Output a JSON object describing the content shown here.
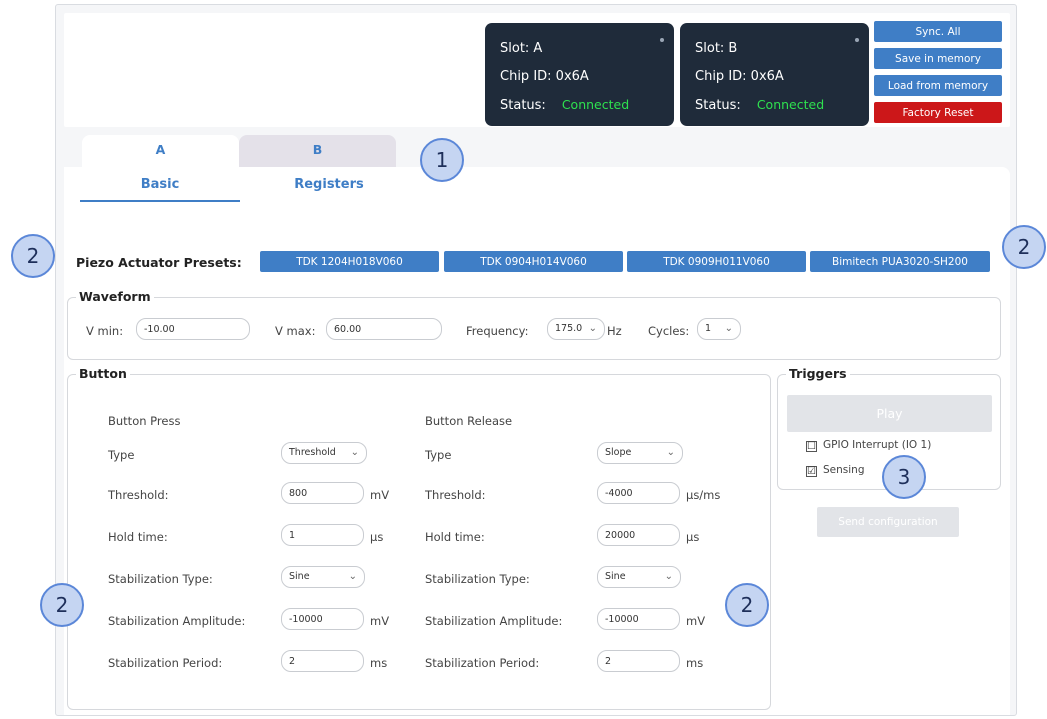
{
  "slots": [
    {
      "slot_label": "Slot: A",
      "chip_label": "Chip ID: 0x6A",
      "status_label": "Status:",
      "status_value": "Connected"
    },
    {
      "slot_label": "Slot: B",
      "chip_label": "Chip ID: 0x6A",
      "status_label": "Status:",
      "status_value": "Connected"
    }
  ],
  "commands": {
    "sync_all": "Sync. All",
    "save_memory": "Save in memory",
    "load_memory": "Load from memory",
    "factory_reset": "Factory Reset"
  },
  "tabs": {
    "a": "A",
    "b": "B"
  },
  "subtabs": {
    "basic": "Basic",
    "registers": "Registers"
  },
  "presets": {
    "label": "Piezo Actuator Presets:",
    "items": [
      "TDK 1204H018V060",
      "TDK 0904H014V060",
      "TDK 0909H011V060",
      "Bimitech PUA3020-SH200"
    ]
  },
  "waveform": {
    "legend": "Waveform",
    "vmin_label": "V min:",
    "vmin_value": "-10.00",
    "vmax_label": "V max:",
    "vmax_value": "60.00",
    "freq_label": "Frequency:",
    "freq_value": "175.0",
    "freq_unit": "Hz",
    "cycles_label": "Cycles:",
    "cycles_value": "1"
  },
  "button": {
    "legend": "Button",
    "press": {
      "title": "Button Press",
      "type_label": "Type",
      "type_value": "Threshold",
      "threshold_label": "Threshold:",
      "threshold_value": "800",
      "threshold_unit": "mV",
      "hold_label": "Hold time:",
      "hold_value": "1",
      "hold_unit": "µs",
      "stab_type_label": "Stabilization Type:",
      "stab_type_value": "Sine",
      "stab_amp_label": "Stabilization Amplitude:",
      "stab_amp_value": "-10000",
      "stab_amp_unit": "mV",
      "stab_period_label": "Stabilization Period:",
      "stab_period_value": "2",
      "stab_period_unit": "ms"
    },
    "release": {
      "title": "Button Release",
      "type_label": "Type",
      "type_value": "Slope",
      "threshold_label": "Threshold:",
      "threshold_value": "-4000",
      "threshold_unit": "µs/ms",
      "hold_label": "Hold time:",
      "hold_value": "20000",
      "hold_unit": "µs",
      "stab_type_label": "Stabilization Type:",
      "stab_type_value": "Sine",
      "stab_amp_label": "Stabilization Amplitude:",
      "stab_amp_value": "-10000",
      "stab_amp_unit": "mV",
      "stab_period_label": "Stabilization Period:",
      "stab_period_value": "2",
      "stab_period_unit": "ms"
    }
  },
  "triggers": {
    "legend": "Triggers",
    "play": "Play",
    "gpio_label": "GPIO Interrupt (IO 1)",
    "gpio_checked": "☐",
    "sensing_label": "Sensing",
    "sensing_checked": "☑",
    "send_config": "Send configuration"
  },
  "callouts": [
    "1",
    "2",
    "2",
    "2",
    "2",
    "3"
  ],
  "colors": {
    "accent": "#3f7ec6",
    "danger": "#cc1719",
    "connected": "#2ee04f",
    "slot_bg": "#1f2b3a"
  }
}
